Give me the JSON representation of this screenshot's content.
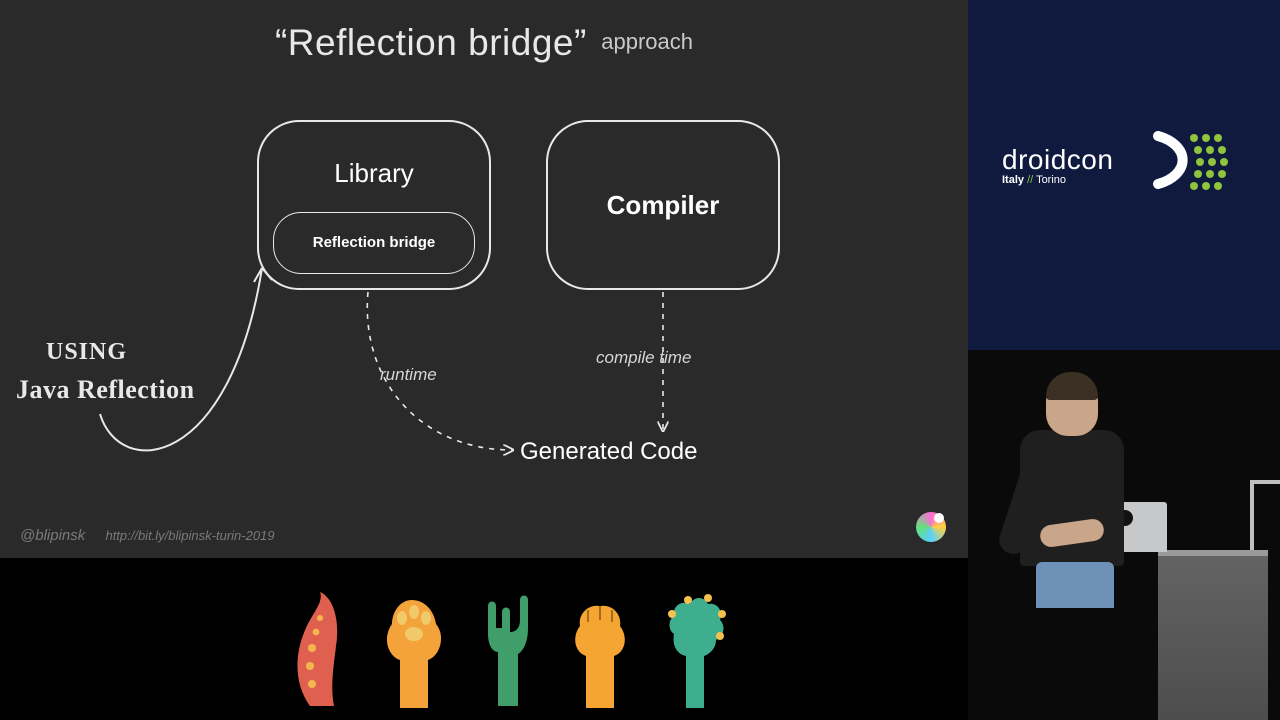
{
  "title": {
    "main": "“Reflection bridge”",
    "sub": "approach"
  },
  "boxes": {
    "library": "Library",
    "inner": "Reflection bridge",
    "compiler": "Compiler"
  },
  "target": "Generated Code",
  "annotations": {
    "runtime": "runtime",
    "compile": "compile time"
  },
  "aside": {
    "line1": "USING",
    "line2": "Java Reflection"
  },
  "footer": {
    "handle": "@blipinsk",
    "url": "http://bit.ly/blipinsk-turin-2019"
  },
  "brand": {
    "name": "droidcon",
    "loc1": "Italy",
    "sep": "//",
    "loc2": "Torino"
  }
}
